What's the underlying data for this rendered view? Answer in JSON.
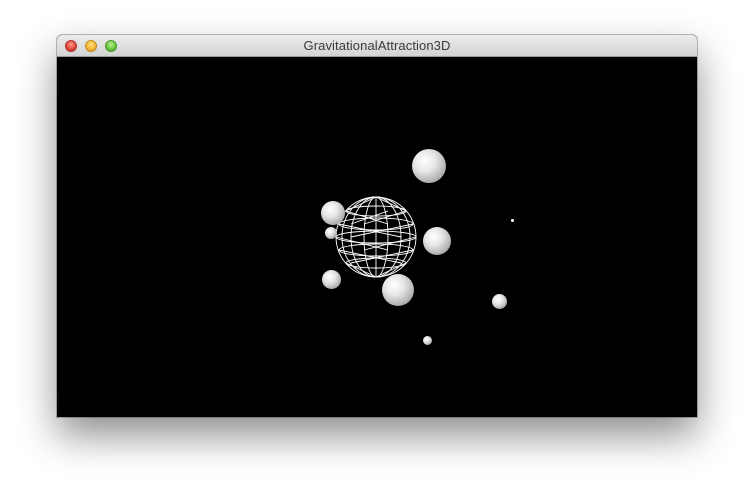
{
  "window": {
    "title": "GravitationalAttraction3D"
  },
  "controls": {
    "close": "close-button",
    "minimize": "minimize-button",
    "zoom": "zoom-button"
  },
  "scene": {
    "background": "#000000",
    "sphere_color": "#ffffff",
    "wireframe_color": "#ffffff"
  }
}
